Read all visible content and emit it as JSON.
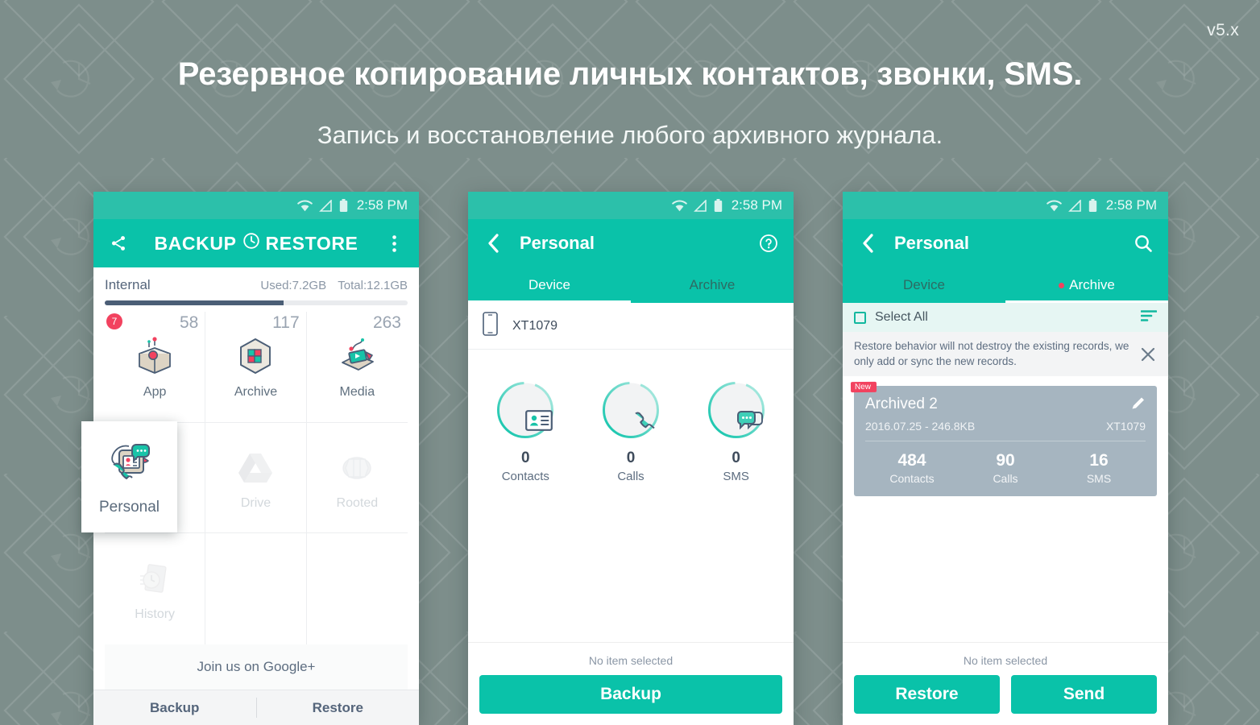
{
  "page": {
    "version_tag": "v5.x",
    "title": "Резервное копирование личных контактов, звонки, SMS.",
    "subtitle": "Запись и восстановление любого архивного журнала.",
    "background_color": "#7d8e8b",
    "accent_color": "#0ac2a9",
    "accent_dim_color": "#2cc0aa",
    "badge_color": "#f2425f",
    "card_color": "#a6b5c0"
  },
  "phone1": {
    "status_bar": {
      "time": "2:58 PM",
      "icons": [
        "wifi-icon",
        "signal-icon",
        "battery-icon"
      ]
    },
    "app_bar": {
      "share_icon": "share-icon",
      "title": "BACKUP",
      "title_icon": "clock-restore-icon",
      "title_2": "RESTORE",
      "overflow_icon": "more-vert-icon"
    },
    "storage": {
      "label": "Internal",
      "used": "Used:7.2GB",
      "total": "Total:12.1GB",
      "percent": 59
    },
    "grid": [
      {
        "label": "App",
        "count": "58",
        "badge": "7",
        "icon": "app-box-icon",
        "enabled": true
      },
      {
        "label": "Archive",
        "count": "117",
        "badge": "",
        "icon": "archive-cube-icon",
        "enabled": true
      },
      {
        "label": "Media",
        "count": "263",
        "badge": "",
        "icon": "media-icon",
        "enabled": true
      },
      {
        "label": "Personal",
        "count": "",
        "badge": "",
        "icon": "personal-icon",
        "enabled": true
      },
      {
        "label": "Drive",
        "count": "",
        "badge": "",
        "icon": "drive-icon",
        "enabled": false
      },
      {
        "label": "Rooted",
        "count": "",
        "badge": "",
        "icon": "rooted-icon",
        "enabled": false
      },
      {
        "label": "History",
        "count": "",
        "badge": "",
        "icon": "history-icon",
        "enabled": false
      },
      {
        "label": "",
        "count": "",
        "badge": "",
        "icon": "",
        "enabled": false
      },
      {
        "label": "",
        "count": "",
        "badge": "",
        "icon": "",
        "enabled": false
      }
    ],
    "google_plus": "Join us on Google+",
    "bottom_nav": [
      "Backup",
      "Restore"
    ]
  },
  "personal_card": {
    "label": "Personal",
    "icon": "personal-contacts-icon"
  },
  "phone2": {
    "status_bar": {
      "time": "2:58 PM"
    },
    "app_bar": {
      "back_icon": "back-arrow-icon",
      "title": "Personal",
      "help_icon": "help-circle-icon"
    },
    "tabs": [
      {
        "label": "Device",
        "active": true,
        "dot": false
      },
      {
        "label": "Archive",
        "active": false,
        "dot": false
      }
    ],
    "device": {
      "icon": "phone-icon",
      "name": "XT1079"
    },
    "rings": [
      {
        "icon": "contact-card-icon",
        "value": "0",
        "label": "Contacts",
        "percent": 78
      },
      {
        "icon": "phone-handset-icon",
        "value": "0",
        "label": "Calls",
        "percent": 78
      },
      {
        "icon": "sms-bubble-icon",
        "value": "0",
        "label": "SMS",
        "percent": 78
      }
    ],
    "footer": {
      "status": "No item selected",
      "buttons": [
        "Backup"
      ]
    }
  },
  "phone3": {
    "status_bar": {
      "time": "2:58 PM"
    },
    "app_bar": {
      "back_icon": "back-arrow-icon",
      "title": "Personal",
      "search_icon": "search-icon"
    },
    "tabs": [
      {
        "label": "Device",
        "active": false,
        "dot": false
      },
      {
        "label": "Archive",
        "active": true,
        "dot": true
      }
    ],
    "select_all": {
      "label": "Select All",
      "checked": false,
      "sort_icon": "sort-icon"
    },
    "info_banner": {
      "text": "Restore behavior will not destroy the existing records, we only add or sync the new records.",
      "close_icon": "close-icon"
    },
    "archive_item": {
      "badge": "New",
      "title": "Archived 2",
      "subtitle": "2016.07.25 - 246.8KB",
      "device": "XT1079",
      "edit_icon": "pencil-icon",
      "stats": [
        {
          "value": "484",
          "label": "Contacts"
        },
        {
          "value": "90",
          "label": "Calls"
        },
        {
          "value": "16",
          "label": "SMS"
        }
      ]
    },
    "footer": {
      "status": "No item selected",
      "buttons": [
        "Restore",
        "Send"
      ]
    }
  }
}
